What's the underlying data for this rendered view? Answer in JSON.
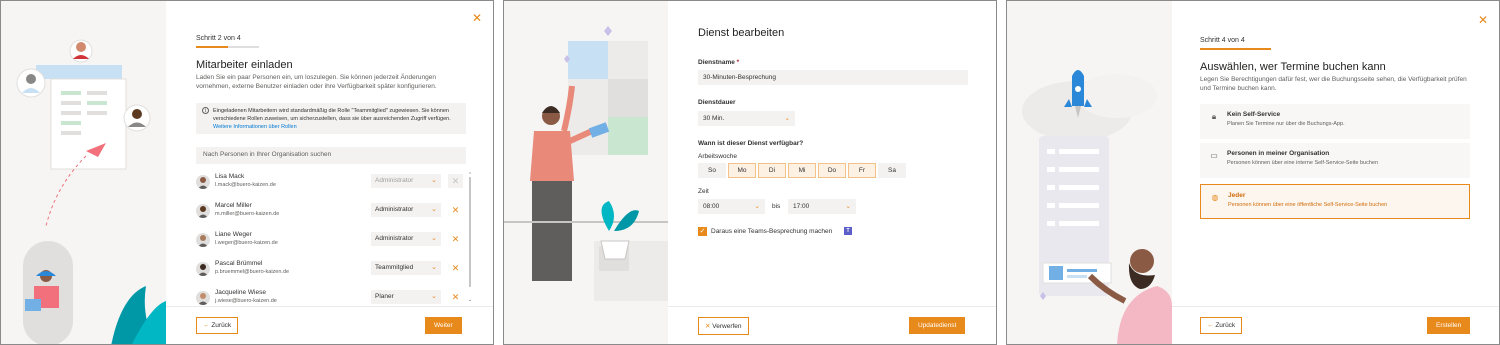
{
  "panel1": {
    "step": "Schritt 2 von 4",
    "progress": 0.5,
    "title": "Mitarbeiter einladen",
    "description": "Laden Sie ein paar Personen ein, um loszulegen. Sie können jederzeit Änderungen vornehmen, externe Benutzer einladen oder ihre Verfügbarkeit später konfigurieren.",
    "info_text": "Eingeladenen Mitarbeitern wird standardmäßig die Rolle \"Teammitglied\" zugewiesen. Sie können verschiedene Rollen zuweisen, um sicherzustellen, dass sie über ausreichenden Zugriff verfügen.",
    "info_link": "Weitere Informationen über Rollen",
    "search_placeholder": "Nach Personen in Ihrer Organisation suchen",
    "people": [
      {
        "name": "Lisa Mack",
        "email": "l.mack@buero-kaizen.de",
        "role": "Administrator",
        "disabled": true
      },
      {
        "name": "Marcel Miller",
        "email": "m.miller@buero-kaizen.de",
        "role": "Administrator",
        "disabled": false
      },
      {
        "name": "Liane Weger",
        "email": "l.weger@buero-kaizen.de",
        "role": "Administrator",
        "disabled": false
      },
      {
        "name": "Pascal Brümmel",
        "email": "p.bruemmel@buero-kaizen.de",
        "role": "Teammitglied",
        "disabled": false
      },
      {
        "name": "Jacqueline Wiese",
        "email": "j.wiese@buero-kaizen.de",
        "role": "Planer",
        "disabled": false
      }
    ],
    "back_label": "Zurück",
    "next_label": "Weiter"
  },
  "panel2": {
    "title": "Dienst bearbeiten",
    "name_label": "Dienstname",
    "name_required": "*",
    "name_value": "30-Minuten-Besprechung",
    "duration_label": "Dienstdauer",
    "duration_value": "30 Min.",
    "availability_label": "Wann ist dieser Dienst verfügbar?",
    "workweek_label": "Arbeitswoche",
    "days": [
      {
        "label": "So",
        "on": false
      },
      {
        "label": "Mo",
        "on": true
      },
      {
        "label": "Di",
        "on": true
      },
      {
        "label": "Mi",
        "on": true
      },
      {
        "label": "Do",
        "on": true
      },
      {
        "label": "Fr",
        "on": true
      },
      {
        "label": "Sa",
        "on": false
      }
    ],
    "time_label": "Zeit",
    "time_from": "08:00",
    "time_sep": "bis",
    "time_to": "17:00",
    "teams_label": "Daraus eine Teams-Besprechung machen",
    "teams_checked": true,
    "discard_label": "Verwerfen",
    "update_label": "Updatedienst"
  },
  "panel3": {
    "step": "Schritt 4 von 4",
    "progress": 1.0,
    "title": "Auswählen, wer Termine buchen kann",
    "description": "Legen Sie Berechtigungen dafür fest, wer die Buchungsseite sehen, die Verfügbarkeit prüfen und Termine buchen kann.",
    "options": [
      {
        "title": "Kein Self-Service",
        "desc": "Planen Sie Termine nur über die Buchungs-App.",
        "icon": "lock-icon",
        "selected": false
      },
      {
        "title": "Personen in meiner Organisation",
        "desc": "Personen können über eine interne Self-Service-Seite buchen",
        "icon": "briefcase-icon",
        "selected": false
      },
      {
        "title": "Jeder",
        "desc": "Personen können über eine öffentliche Self-Service-Seite buchen",
        "icon": "globe-icon",
        "selected": true
      }
    ],
    "back_label": "Zurück",
    "create_label": "Erstellen"
  },
  "colors": {
    "accent": "#e8891b",
    "field_bg": "#f3f2f1",
    "illustration_bg": "#f6f5f3"
  }
}
